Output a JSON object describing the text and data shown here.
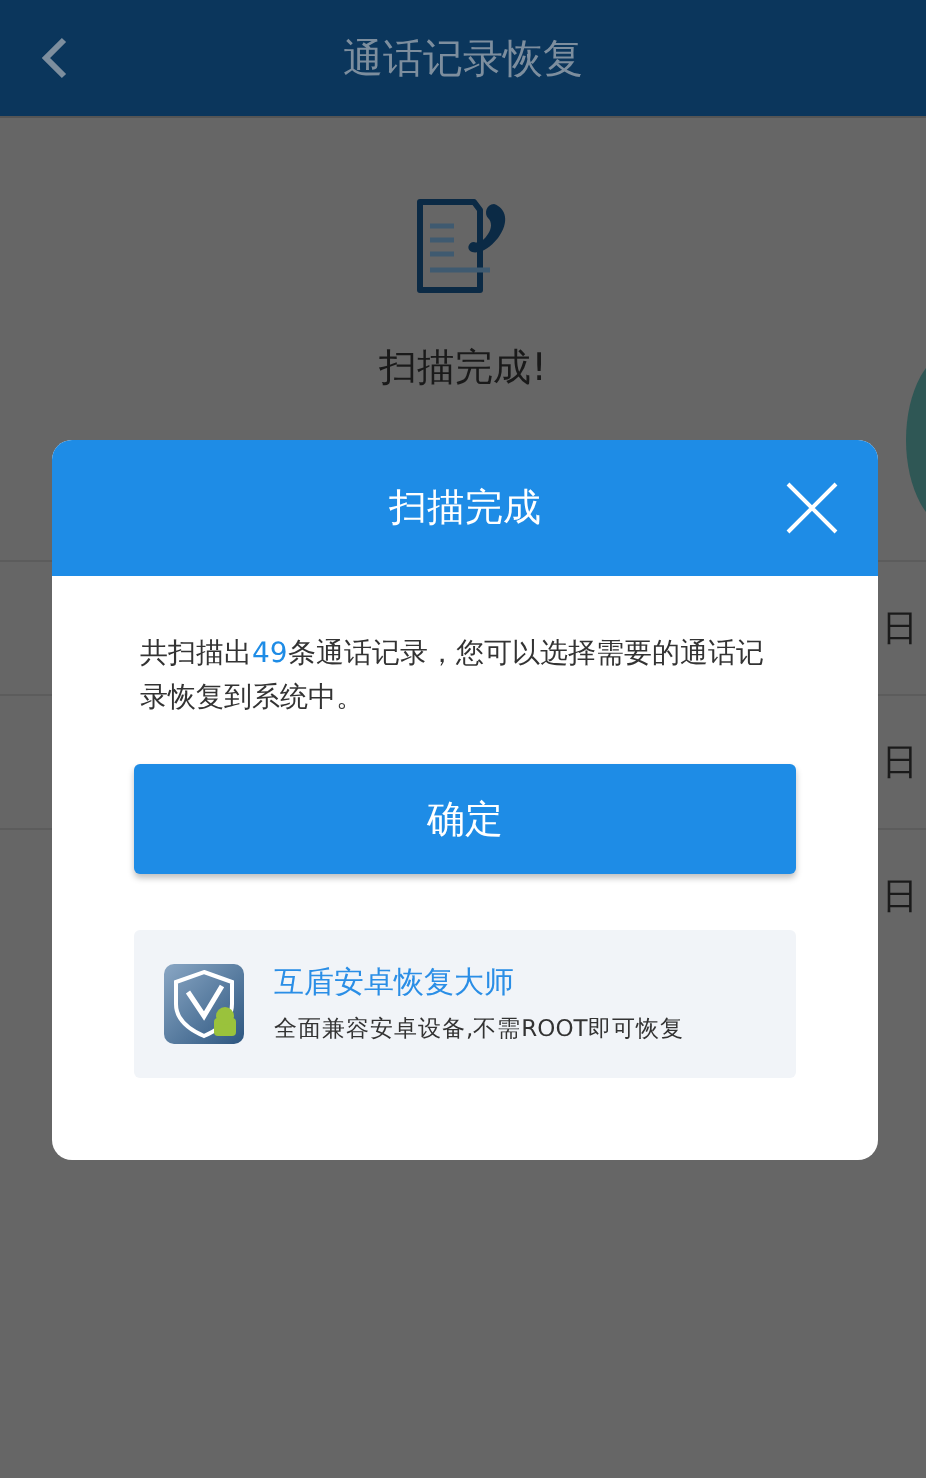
{
  "header": {
    "title": "通话记录恢复"
  },
  "scan_status": "扫描完成!",
  "list_rows": [
    {
      "text": "日"
    },
    {
      "text": "日"
    },
    {
      "text": "日"
    }
  ],
  "dialog": {
    "title": "扫描完成",
    "message": {
      "before": "共扫描出",
      "count": "49",
      "after": "条通话记录，您可以选择需要的通话记录恢复到系统中。"
    },
    "confirm_button": "确定",
    "promo": {
      "title": "互盾安卓恢复大师",
      "subtitle": "全面兼容安卓设备,不需ROOT即可恢复"
    }
  }
}
